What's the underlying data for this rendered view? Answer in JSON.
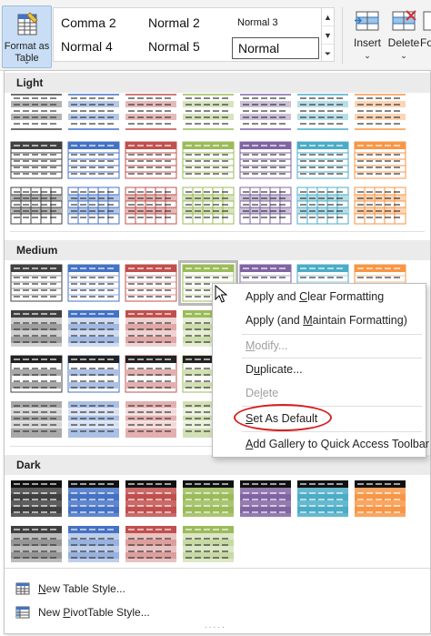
{
  "ribbon": {
    "format_as_table": {
      "line1": "Format as",
      "line2": "Table",
      "chevron": "⌄",
      "icon": "format-table-icon"
    },
    "cell_styles": {
      "row1": [
        "Comma 2",
        "Normal 2",
        "Normal 3"
      ],
      "row2": [
        "Normal 4",
        "Normal 5",
        "Normal"
      ],
      "scroll": [
        "▲",
        "▼",
        "⏷"
      ]
    },
    "insert": {
      "label": "Insert",
      "chevron": "⌄",
      "icon": "insert-cells-icon"
    },
    "delete": {
      "label": "Delete",
      "chevron": "⌄",
      "icon": "delete-cells-icon"
    },
    "format": {
      "label": "Fo",
      "icon": "format-cells-icon"
    }
  },
  "gallery": {
    "sections": [
      "Light",
      "Medium",
      "Dark"
    ],
    "colors": {
      "black": "#404040",
      "blue": "#4472c4",
      "red": "#c0504d",
      "green": "#9bbb59",
      "purple": "#8064a2",
      "teal": "#4bacc6",
      "orange": "#f79646"
    }
  },
  "context_menu": {
    "apply_clear": {
      "pre": "Apply and ",
      "ul": "C",
      "post": "lear Formatting"
    },
    "apply_maintain": {
      "pre": "Apply (and ",
      "ul": "M",
      "post": "aintain Formatting)"
    },
    "modify": {
      "pre": "",
      "ul": "M",
      "post": "odify..."
    },
    "duplicate": {
      "pre": "D",
      "ul": "u",
      "post": "plicate..."
    },
    "delete": {
      "pre": "De",
      "ul": "l",
      "post": "ete"
    },
    "set_default": {
      "pre": "",
      "ul": "S",
      "post": "et As Default"
    },
    "add_gallery": {
      "pre": "",
      "ul": "A",
      "post": "dd Gallery to Quick Access Toolbar"
    }
  },
  "footer": {
    "new_table_style": {
      "pre": "",
      "ul": "N",
      "post": "ew Table Style..."
    },
    "new_pivot_style": {
      "pre": "New ",
      "ul": "P",
      "post": "ivotTable Style..."
    },
    "grip": "....."
  }
}
